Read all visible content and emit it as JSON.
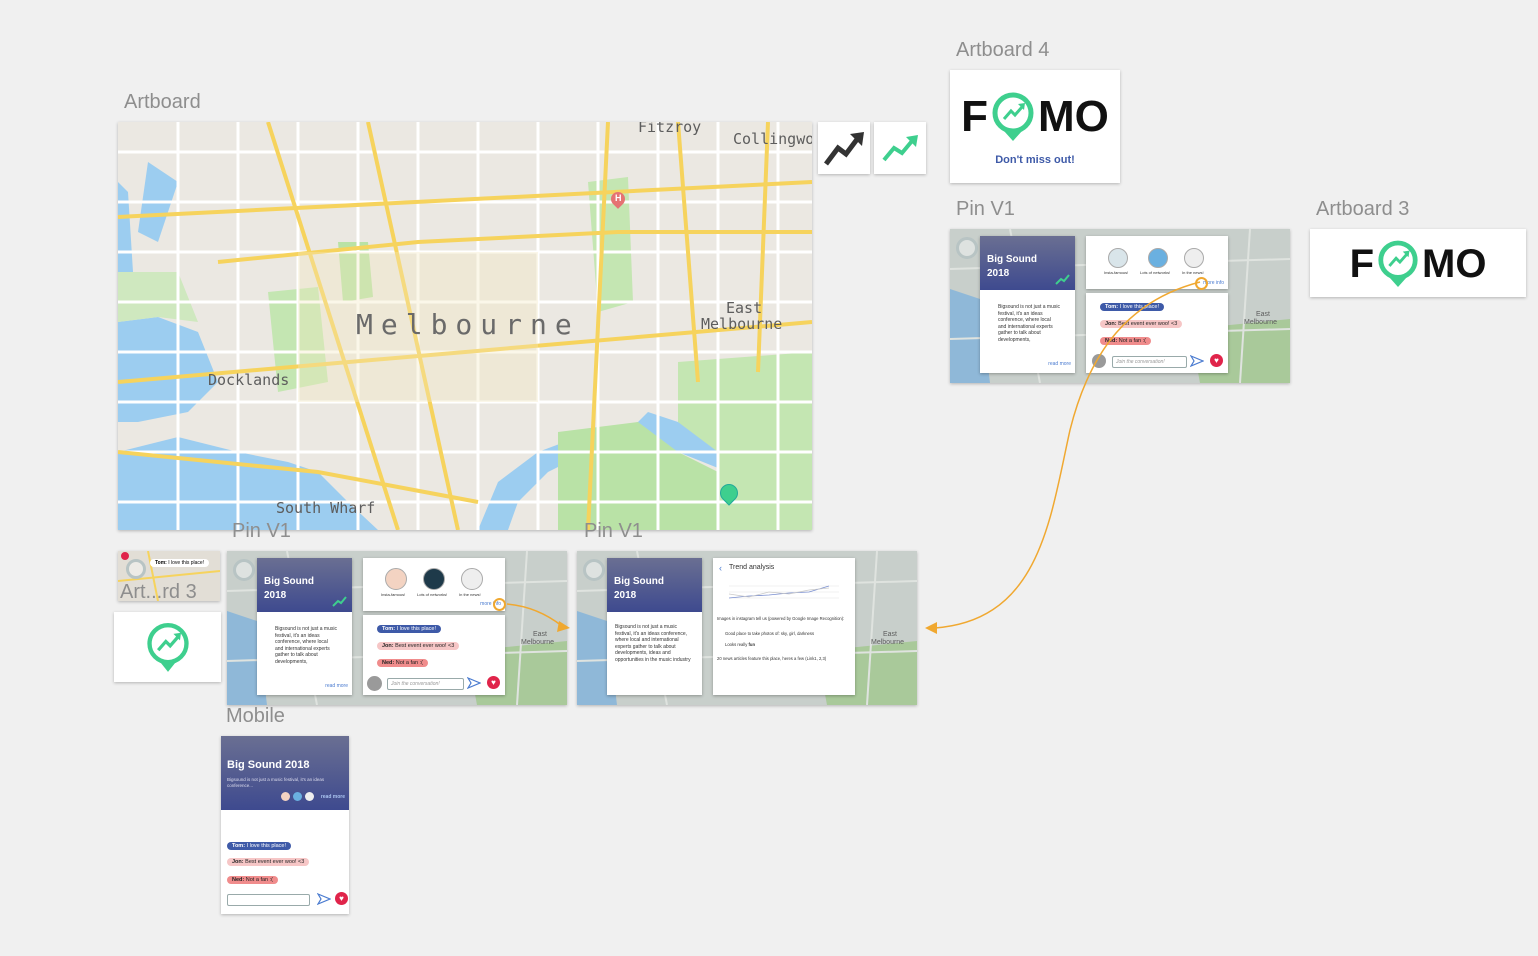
{
  "labels": {
    "artboard": "Artboard",
    "artboard4": "Artboard 4",
    "artboard3": "Artboard 3",
    "pin_v1_right": "Pin V1",
    "pin_v1_a": "Pin V1",
    "pin_v1_b": "Pin V1",
    "art_rd3": "Art...rd 3",
    "mobile": "Mobile"
  },
  "map": {
    "city": "Melbourne",
    "docklands": "Docklands",
    "south_wharf": "South Wharf",
    "east_melbourne_1": "East",
    "east_melbourne_2": "Melbourne",
    "fitzroy": "Fitzroy",
    "collingwood": "Collingwo",
    "hospital_pin": "H"
  },
  "logo": {
    "left": "F",
    "right": "MO",
    "tagline": "Don't miss out!"
  },
  "event": {
    "title_line1": "Big Sound",
    "title_line2": "2018",
    "mobile_title": "Big Sound 2018",
    "mobile_sub": "Bigsound is not just a music festival, it's an ideas conference...",
    "description_short": "Bigsound is not just a music festival, it's an ideas conference, where local and international experts gather to talk about developments,",
    "description_long": "Bigsound is not just a music festival, it's an ideas conference, where local and international experts gather to talk about developments, ideas and opportunities in the music industry",
    "read_more": "read more"
  },
  "badges": {
    "insta": "Insta-famous!",
    "networks": "Lots of networks!",
    "news": "In the news!",
    "more_info": "more info"
  },
  "chat": {
    "tom_name": "Tom:",
    "tom_msg": "I love this place!",
    "jon_name": "Jon:",
    "jon_msg": "Best event ever woo! <3",
    "ned_name": "Ned:",
    "ned_msg": "Not a fan :(",
    "placeholder": "Join the conversation!"
  },
  "trend": {
    "title": "Trend analysis",
    "line1": "Images in instagram tell us (powered by Google Image Recognition):",
    "line2": "Good place to take photos of: sky, girl, darkness",
    "line3_prefix": "Looks really",
    "line3_bold": "fun",
    "line4": "20 news articles feature this place, heres a few (Link1, 2,3)"
  },
  "colors": {
    "accent_green": "#3ecf8e",
    "brand_blue": "#3e5aa8",
    "flow_orange": "#f0a830",
    "heart_red": "#e0244a"
  }
}
